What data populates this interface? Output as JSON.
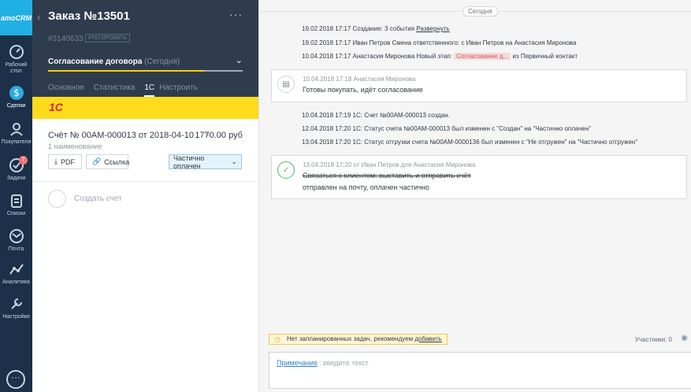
{
  "nav": {
    "logo": "amoCRM",
    "items": [
      {
        "label": "Рабочий стол"
      },
      {
        "label": "Сделки"
      },
      {
        "label": "Покупатели"
      },
      {
        "label": "Задачи",
        "badge": "7"
      },
      {
        "label": "Списки"
      },
      {
        "label": "Почта"
      },
      {
        "label": "Аналитика"
      },
      {
        "label": "Настройки"
      }
    ]
  },
  "deal": {
    "title": "Заказ №13501",
    "id": "#3140633",
    "tag_button": "#ТЕГИРОВАТЬ",
    "stage": "Согласование договора",
    "stage_date": "(Сегодня)",
    "tabs": [
      "Основное",
      "Статистика",
      "1С",
      "Настроить"
    ],
    "onec_logo": "1С",
    "invoice": {
      "title": "Счёт № 00АМ-000013 от 2018-04-10",
      "sum": "1770.00 руб",
      "sub": "1 наименование",
      "pdf_label": "PDF",
      "link_label": "Ссылка",
      "status": "Частично оплачен"
    },
    "create_invoice": "Создать счет"
  },
  "feed": {
    "today": "Сегодня",
    "events_top": [
      {
        "date": "19.02.2018 17:17",
        "text": "Создание: 3 события ",
        "link": "Развернуть"
      },
      {
        "date": "19.02.2018 17:17",
        "text": "Иван Петров  Смена ответственного: с Иван Петров на Анастасия Миронова"
      },
      {
        "date": "10.04.2018 17:17",
        "text": "Анастасия Миронова  Новый этап: ",
        "tag": "Согласование д...",
        "after": " из Первичный контакт"
      }
    ],
    "note1": {
      "meta": "10.04.2018 17:18 Анастасия Миронова",
      "text": "Готовы покупать, идёт согласование"
    },
    "events_mid": [
      {
        "date": "10.04.2018 17:19",
        "text": "1С: Счет №00АМ-000013 создан."
      },
      {
        "date": "12.04.2018 17:20",
        "text": "1С: Статус счета №00АМ-000013 был изменен с \"Создан\" на \"Частично оплачен\""
      },
      {
        "date": "13.04.2018 17:20",
        "text": "1С: Статус отгрузки счета №00АМ-0000136 был изменен с \"Не отгружен\" на \"Частично отгружен\""
      }
    ],
    "note2": {
      "meta": "13.04.2018 17:20  от Иван Петров для Анастасия Миронова",
      "text": "Связаться с клиентом: выставить и отправить счёт",
      "text2": "отправлен на почту, оплачен частично"
    },
    "tasks_warning": "Нет запланированных задач, рекомендуем ",
    "tasks_warning_link": "добавить",
    "participants": "Участники: 0",
    "composer_label": "Примечание",
    "composer_placeholder": ": введите текст"
  }
}
